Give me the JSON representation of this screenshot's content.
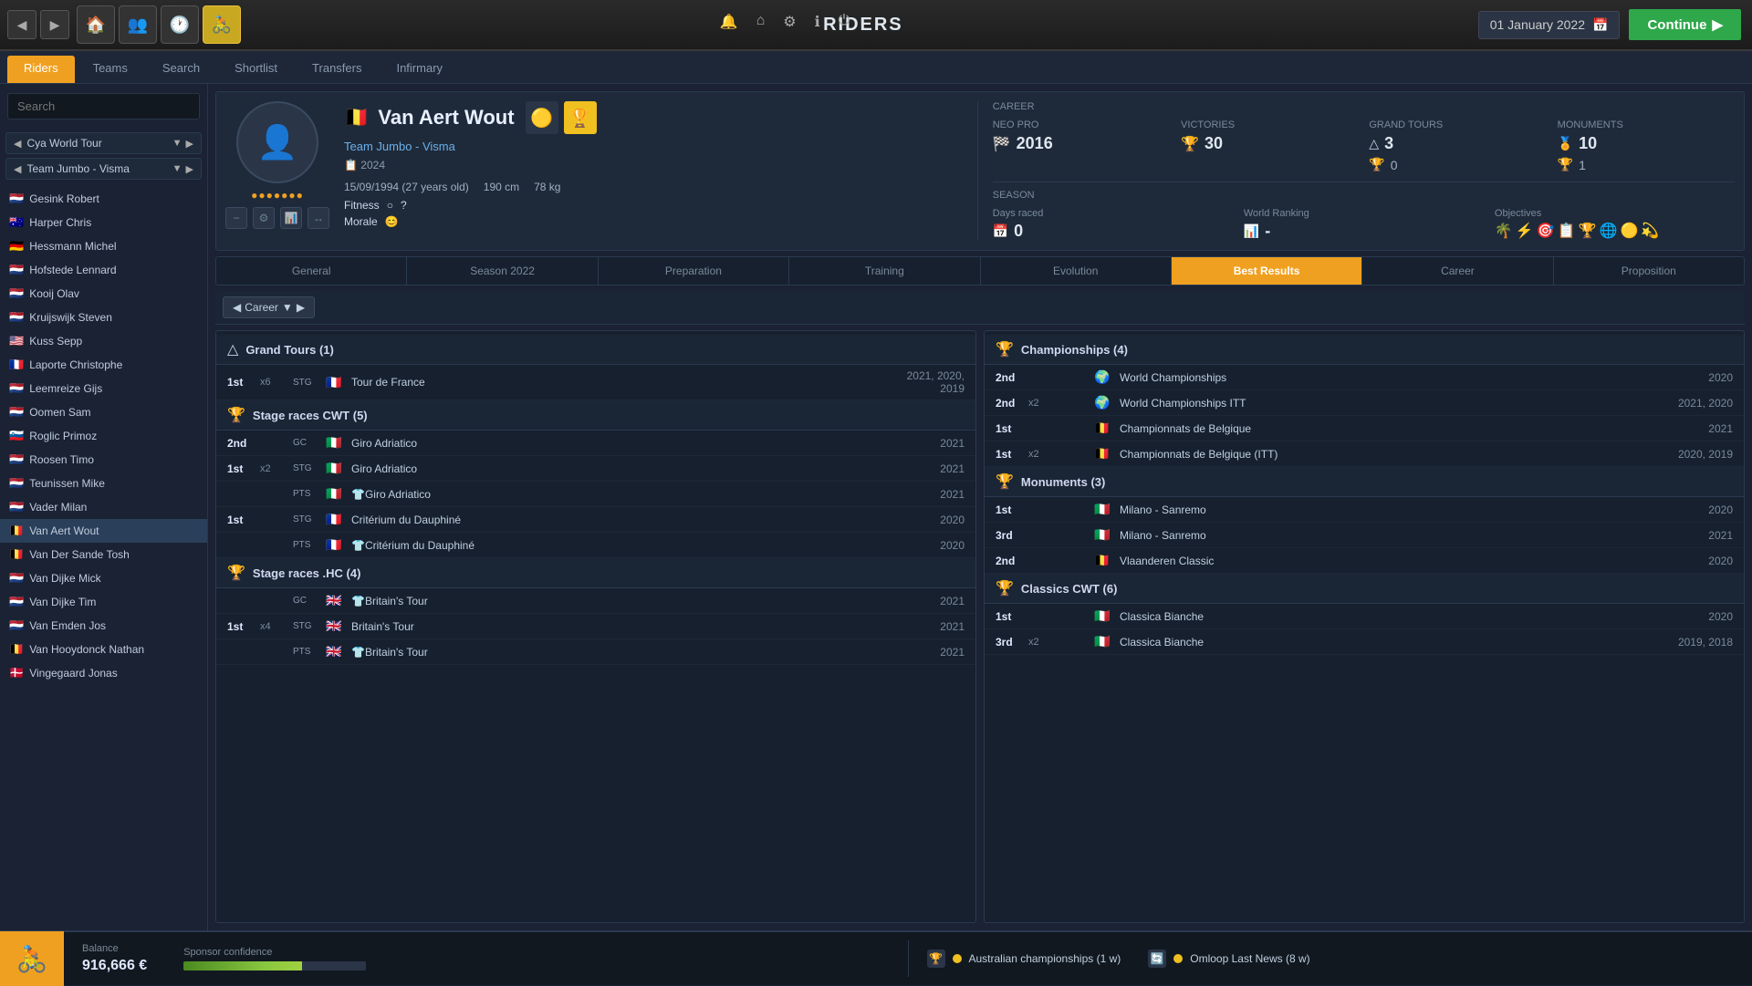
{
  "app": {
    "title": "RIDERS",
    "date": "01 January 2022",
    "continue_label": "Continue"
  },
  "nav": {
    "tabs": [
      {
        "label": "Riders",
        "active": true
      },
      {
        "label": "Teams",
        "active": false
      },
      {
        "label": "Search",
        "active": false
      },
      {
        "label": "Shortlist",
        "active": false
      },
      {
        "label": "Transfers",
        "active": false
      },
      {
        "label": "Infirmary",
        "active": false
      }
    ]
  },
  "sidebar": {
    "search_placeholder": "Search",
    "filters": [
      {
        "label": "Cya World Tour"
      },
      {
        "label": "Team Jumbo - Visma"
      }
    ],
    "riders": [
      {
        "name": "Gesink Robert",
        "flag": "🇳🇱",
        "active": false
      },
      {
        "name": "Harper Chris",
        "flag": "🇦🇺",
        "active": false
      },
      {
        "name": "Hessmann Michel",
        "flag": "🇩🇪",
        "active": false
      },
      {
        "name": "Hofstede Lennard",
        "flag": "🇳🇱",
        "active": false
      },
      {
        "name": "Kooij Olav",
        "flag": "🇳🇱",
        "active": false
      },
      {
        "name": "Kruijswijk Steven",
        "flag": "🇳🇱",
        "active": false
      },
      {
        "name": "Kuss Sepp",
        "flag": "🇺🇸",
        "active": false
      },
      {
        "name": "Laporte Christophe",
        "flag": "🇫🇷",
        "active": false
      },
      {
        "name": "Leemreize Gijs",
        "flag": "🇳🇱",
        "active": false
      },
      {
        "name": "Oomen Sam",
        "flag": "🇳🇱",
        "active": false
      },
      {
        "name": "Roglic Primoz",
        "flag": "🇸🇮",
        "active": false
      },
      {
        "name": "Roosen Timo",
        "flag": "🇳🇱",
        "active": false
      },
      {
        "name": "Teunissen Mike",
        "flag": "🇳🇱",
        "active": false
      },
      {
        "name": "Vader Milan",
        "flag": "🇳🇱",
        "active": false
      },
      {
        "name": "Van Aert Wout",
        "flag": "🇧🇪",
        "active": true
      },
      {
        "name": "Van Der Sande Tosh",
        "flag": "🇧🇪",
        "active": false
      },
      {
        "name": "Van Dijke Mick",
        "flag": "🇳🇱",
        "active": false
      },
      {
        "name": "Van Dijke Tim",
        "flag": "🇳🇱",
        "active": false
      },
      {
        "name": "Van Emden Jos",
        "flag": "🇳🇱",
        "active": false
      },
      {
        "name": "Van Hooydonck Nathan",
        "flag": "🇧🇪",
        "active": false
      },
      {
        "name": "Vingegaard Jonas",
        "flag": "🇩🇰",
        "active": false
      }
    ]
  },
  "rider": {
    "name": "Van Aert Wout",
    "flag": "🇧🇪",
    "team": "Team Jumbo - Visma",
    "contract_year": "2024",
    "birthdate": "15/09/1994 (27 years old)",
    "height": "190 cm",
    "weight": "78 kg",
    "fitness_label": "Fitness",
    "morale_label": "Morale",
    "stars": "●●●●●●●",
    "career": {
      "label": "CAREER",
      "neo_pro_label": "Neo pro",
      "neo_pro_year": "2016",
      "victories_label": "Victories",
      "victories": "30",
      "grand_tours_label": "Grand Tours",
      "grand_tours_1": "3",
      "grand_tours_2": "0",
      "monuments_label": "Monuments",
      "monuments_1": "10",
      "monuments_2": "1"
    },
    "season": {
      "label": "SEASON",
      "days_raced_label": "Days raced",
      "days_raced": "0",
      "world_ranking_label": "World Ranking",
      "world_ranking": "-",
      "objectives_label": "Objectives"
    }
  },
  "tabs": [
    {
      "label": "General",
      "active": false
    },
    {
      "label": "Season 2022",
      "active": false
    },
    {
      "label": "Preparation",
      "active": false
    },
    {
      "label": "Training",
      "active": false
    },
    {
      "label": "Evolution",
      "active": false
    },
    {
      "label": "Best Results",
      "active": true
    },
    {
      "label": "Career",
      "active": false
    },
    {
      "label": "Proposition",
      "active": false
    }
  ],
  "filter_bar": {
    "prev": "◀",
    "label": "Career",
    "next": "▶"
  },
  "grand_tours": {
    "section_title": "Grand Tours (1)",
    "entries": [
      {
        "pos": "1st",
        "mult": "x6",
        "type": "STG",
        "flag": "🇫🇷",
        "name": "Tour de France",
        "years": "2021, 2020, 2019"
      }
    ]
  },
  "stage_races_cwt": {
    "section_title": "Stage races CWT (5)",
    "entries": [
      {
        "pos": "2nd",
        "mult": "",
        "type": "GC",
        "flag": "🇮🇹",
        "name": "Giro Adriatico",
        "years": "2021",
        "jersey": ""
      },
      {
        "pos": "1st",
        "mult": "x2",
        "type": "STG",
        "flag": "🇮🇹",
        "name": "Giro Adriatico",
        "years": "2021",
        "jersey": ""
      },
      {
        "pos": "",
        "mult": "",
        "type": "PTS",
        "flag": "🇮🇹",
        "name": "Giro Adriatico",
        "years": "2021",
        "jersey": "👕"
      },
      {
        "pos": "1st",
        "mult": "",
        "type": "STG",
        "flag": "🇫🇷",
        "name": "Critérium du Dauphiné",
        "years": "2020",
        "jersey": ""
      },
      {
        "pos": "",
        "mult": "",
        "type": "PTS",
        "flag": "🇫🇷",
        "name": "Critérium du Dauphiné",
        "years": "2020",
        "jersey": "👕"
      }
    ]
  },
  "stage_races_hc": {
    "section_title": "Stage races .HC (4)",
    "entries": [
      {
        "pos": "",
        "mult": "",
        "type": "GC",
        "flag": "🇬🇧",
        "name": "Britain's Tour",
        "years": "2021",
        "jersey": "👕"
      },
      {
        "pos": "1st",
        "mult": "x4",
        "type": "STG",
        "flag": "🇬🇧",
        "name": "Britain's Tour",
        "years": "2021",
        "jersey": ""
      },
      {
        "pos": "",
        "mult": "",
        "type": "PTS",
        "flag": "🇬🇧",
        "name": "Britain's Tour",
        "years": "2021",
        "jersey": "👕"
      }
    ]
  },
  "championships": {
    "section_title": "Championships (4)",
    "entries": [
      {
        "pos": "2nd",
        "mult": "",
        "flag": "🌍",
        "name": "World Championships",
        "years": "2020"
      },
      {
        "pos": "2nd",
        "mult": "x2",
        "flag": "🌍",
        "name": "World Championships ITT",
        "years": "2021, 2020"
      },
      {
        "pos": "1st",
        "mult": "",
        "flag": "🇧🇪",
        "name": "Championnats de Belgique",
        "years": "2021"
      },
      {
        "pos": "1st",
        "mult": "x2",
        "flag": "🇧🇪",
        "name": "Championnats de Belgique (ITT)",
        "years": "2020, 2019"
      }
    ]
  },
  "monuments": {
    "section_title": "Monuments (3)",
    "entries": [
      {
        "pos": "1st",
        "flag": "🇮🇹",
        "name": "Milano - Sanremo",
        "years": "2020"
      },
      {
        "pos": "3rd",
        "flag": "🇮🇹",
        "name": "Milano - Sanremo",
        "years": "2021"
      },
      {
        "pos": "2nd",
        "flag": "🇧🇪",
        "name": "Vlaanderen Classic",
        "years": "2020"
      }
    ]
  },
  "classics_cwt": {
    "section_title": "Classics CWT (6)",
    "entries": [
      {
        "pos": "1st",
        "flag": "🇮🇹",
        "name": "Classica Bianche",
        "years": "2020"
      },
      {
        "pos": "3rd",
        "mult": "x2",
        "flag": "🇮🇹",
        "name": "Classica Bianche",
        "years": "2019, 2018"
      }
    ]
  },
  "bottom": {
    "balance_label": "Balance",
    "balance_value": "916,666 €",
    "sponsor_label": "Sponsor confidence",
    "news": [
      {
        "icon": "🏆",
        "color": "#f0c020",
        "text": "Australian championships (1 w)"
      },
      {
        "icon": "🔄",
        "color": "#f0c020",
        "text": "Omloop Last News (8 w)"
      }
    ]
  }
}
